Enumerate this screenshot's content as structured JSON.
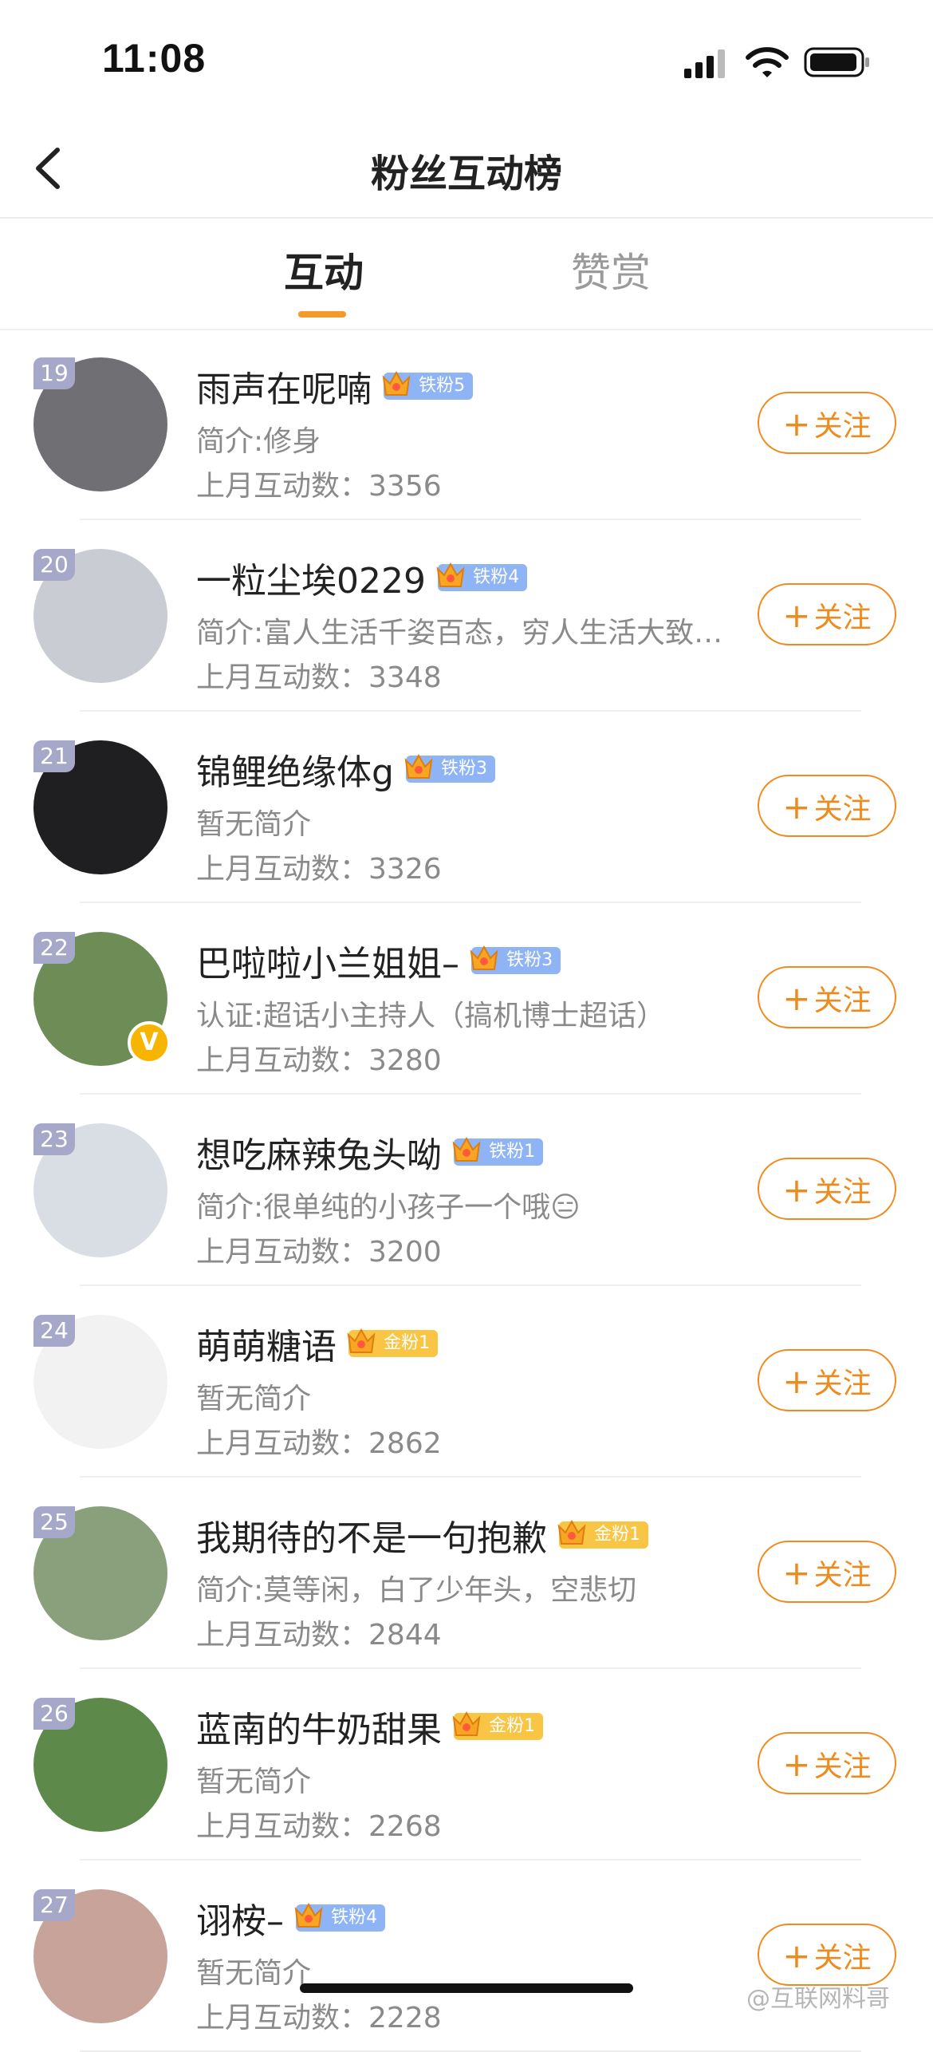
{
  "status_bar": {
    "time": "11:08"
  },
  "nav": {
    "title": "粉丝互动榜"
  },
  "tabs": [
    {
      "label": "互动",
      "active": true
    },
    {
      "label": "赞赏",
      "active": false
    }
  ],
  "follow_label": "关注",
  "count_prefix": "上月互动数：",
  "rows": [
    {
      "rank": "19",
      "name": "雨声在呢喃",
      "badge": "铁粉5",
      "badge_type": "iron",
      "intro": "简介:修身",
      "count": "3356",
      "avatar_color": "#6f6f74",
      "verified": false
    },
    {
      "rank": "20",
      "name": "一粒尘埃0229",
      "badge": "铁粉4",
      "badge_type": "iron",
      "intro": "简介:富人生活千姿百态，穷人生活大致…",
      "count": "3348",
      "avatar_color": "#c9ccd2",
      "verified": false
    },
    {
      "rank": "21",
      "name": "锦鲤绝缘体g",
      "badge": "铁粉3",
      "badge_type": "iron",
      "intro": "暂无简介",
      "count": "3326",
      "avatar_color": "#1f1f22",
      "verified": false
    },
    {
      "rank": "22",
      "name": "巴啦啦小兰姐姐–",
      "badge": "铁粉3",
      "badge_type": "iron",
      "intro": "认证:超话小主持人（搞机博士超话）",
      "count": "3280",
      "avatar_color": "#6e8c55",
      "verified": true
    },
    {
      "rank": "23",
      "name": "想吃麻辣兔头呦",
      "badge": "铁粉1",
      "badge_type": "iron",
      "intro": "简介:很单纯的小孩子一个哦😑",
      "count": "3200",
      "avatar_color": "#d9dde4",
      "verified": false
    },
    {
      "rank": "24",
      "name": "萌萌糖语",
      "badge": "金粉1",
      "badge_type": "gold",
      "intro": "暂无简介",
      "count": "2862",
      "avatar_color": "#f2f2f2",
      "verified": false
    },
    {
      "rank": "25",
      "name": "我期待的不是一句抱歉",
      "badge": "金粉1",
      "badge_type": "gold",
      "intro": "简介:莫等闲，白了少年头，空悲切",
      "count": "2844",
      "avatar_color": "#8aa07d",
      "verified": false
    },
    {
      "rank": "26",
      "name": "蓝南的牛奶甜果",
      "badge": "金粉1",
      "badge_type": "gold",
      "intro": "暂无简介",
      "count": "2268",
      "avatar_color": "#5d8a4a",
      "verified": false
    },
    {
      "rank": "27",
      "name": "诩桉–",
      "badge": "铁粉4",
      "badge_type": "iron",
      "intro": "暂无简介",
      "count": "2228",
      "avatar_color": "#c7a39a",
      "verified": false
    }
  ],
  "watermark": "@互联网料哥"
}
